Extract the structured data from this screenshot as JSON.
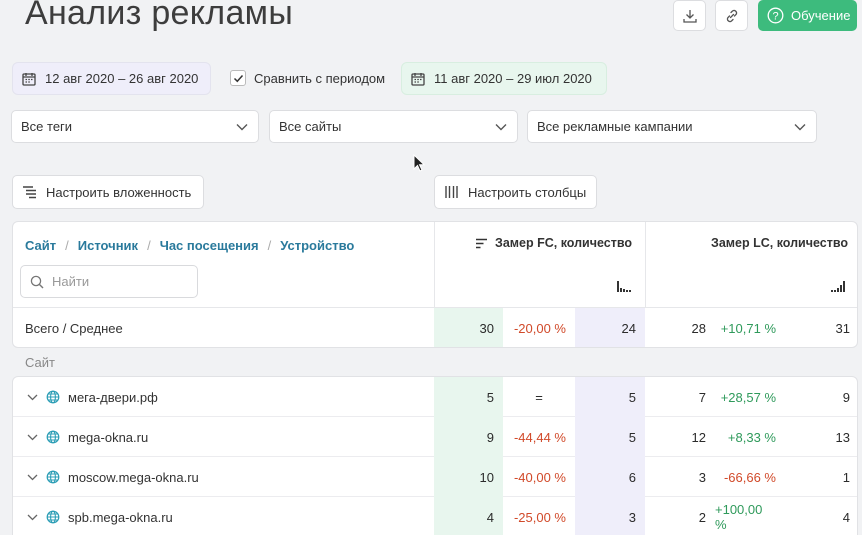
{
  "page_title": "Анализ рекламы",
  "header": {
    "learn_label": "Обучение",
    "download_icon": "download-icon",
    "link_icon": "link-icon"
  },
  "period": {
    "main": "12 авг 2020 – 26 авг 2020",
    "compare_label": "Сравнить с периодом",
    "compare_checked": true,
    "compare": "11 авг 2020 – 29 июл 2020"
  },
  "filters": {
    "tags": "Все теги",
    "sites": "Все сайты",
    "campaigns": "Все рекламные кампании"
  },
  "config": {
    "nesting_label": "Настроить вложенность",
    "columns_label": "Настроить столбцы"
  },
  "table": {
    "breadcrumbs": [
      "Сайт",
      "Источник",
      "Час посещения",
      "Устройство"
    ],
    "search_placeholder": "Найти",
    "col_fc": "Замер FC, количество",
    "col_lc": "Замер LC, количество",
    "totals": {
      "label": "Всего / Среднее",
      "fc": "30",
      "fc_delta": "-20,00 %",
      "fc_prev": "24",
      "lc": "28",
      "lc_delta": "+10,71 %",
      "lc_prev": "31"
    },
    "group_label": "Сайт",
    "rows": [
      {
        "site": "мега-двери.рф",
        "fc": "5",
        "fc_delta": "=",
        "fc_delta_type": "eq",
        "fc_prev": "5",
        "lc": "7",
        "lc_delta": "+28,57 %",
        "lc_delta_type": "pos",
        "lc_prev": "9"
      },
      {
        "site": "mega-okna.ru",
        "fc": "9",
        "fc_delta": "-44,44 %",
        "fc_delta_type": "neg",
        "fc_prev": "5",
        "lc": "12",
        "lc_delta": "+8,33 %",
        "lc_delta_type": "pos",
        "lc_prev": "13"
      },
      {
        "site": "moscow.mega-okna.ru",
        "fc": "10",
        "fc_delta": "-40,00 %",
        "fc_delta_type": "neg",
        "fc_prev": "6",
        "lc": "3",
        "lc_delta": "-66,66 %",
        "lc_delta_type": "neg",
        "lc_prev": "1"
      },
      {
        "site": "spb.mega-okna.ru",
        "fc": "4",
        "fc_delta": "-25,00 %",
        "fc_delta_type": "neg",
        "fc_prev": "3",
        "lc": "2",
        "lc_delta": "+100,00 %",
        "lc_delta_type": "pos",
        "lc_prev": "4"
      }
    ]
  },
  "colors": {
    "accent_green": "#3dbb7d",
    "link_blue": "#2a7a9c",
    "negative": "#d14a2a",
    "positive": "#2f9a5b",
    "current_bg": "#e8f6ee",
    "compare_bg": "#efeefa"
  }
}
